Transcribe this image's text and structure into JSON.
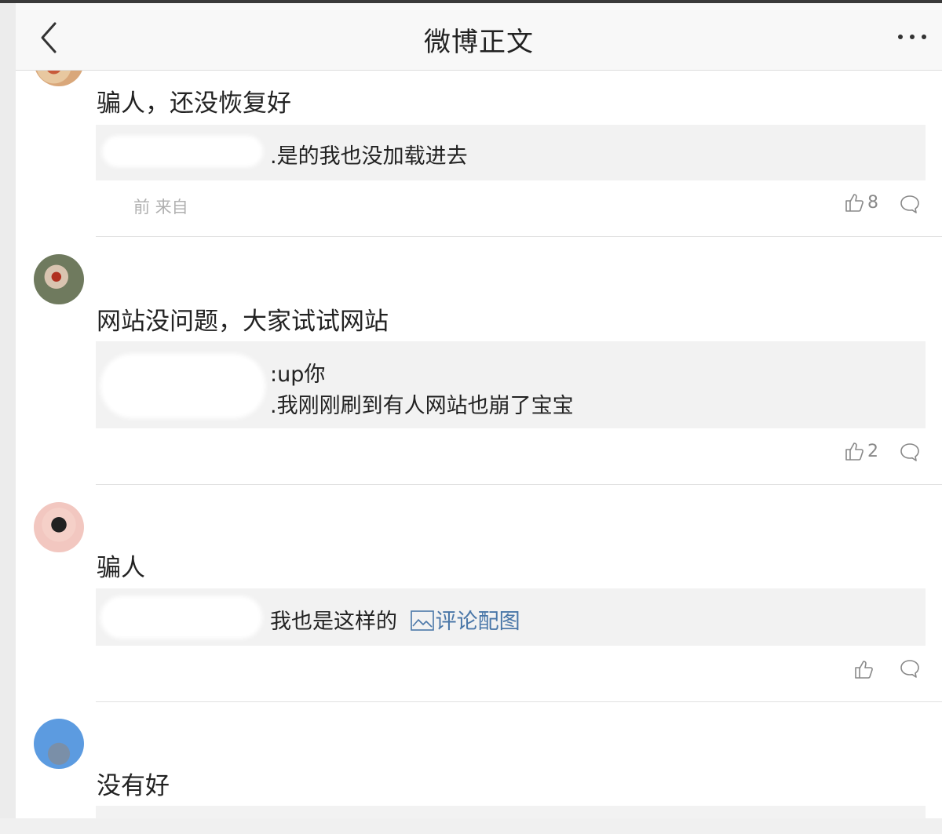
{
  "navbar": {
    "title": "微博正文",
    "back_icon": "chevron-left-icon",
    "more_icon": "more-dots-icon"
  },
  "comments": [
    {
      "text": "骗人，还没恢复好",
      "reply_lines": [
        ".是的我也没加载进去"
      ],
      "meta": "前 来自",
      "likes": "8"
    },
    {
      "text": "网站没问题，大家试试网站",
      "reply_lines": [
        ":up你",
        ".我刚刚刷到有人网站也崩了宝宝"
      ],
      "likes": "2"
    },
    {
      "text": "骗人",
      "reply_text": "我也是这样的",
      "reply_link": "评论配图",
      "likes": ""
    },
    {
      "text": "没有好"
    }
  ],
  "colors": {
    "link": "#4a77a8",
    "reply_bg": "#f2f2f2",
    "navbar_bg": "#f8f8f8",
    "icon_gray": "#888888"
  }
}
